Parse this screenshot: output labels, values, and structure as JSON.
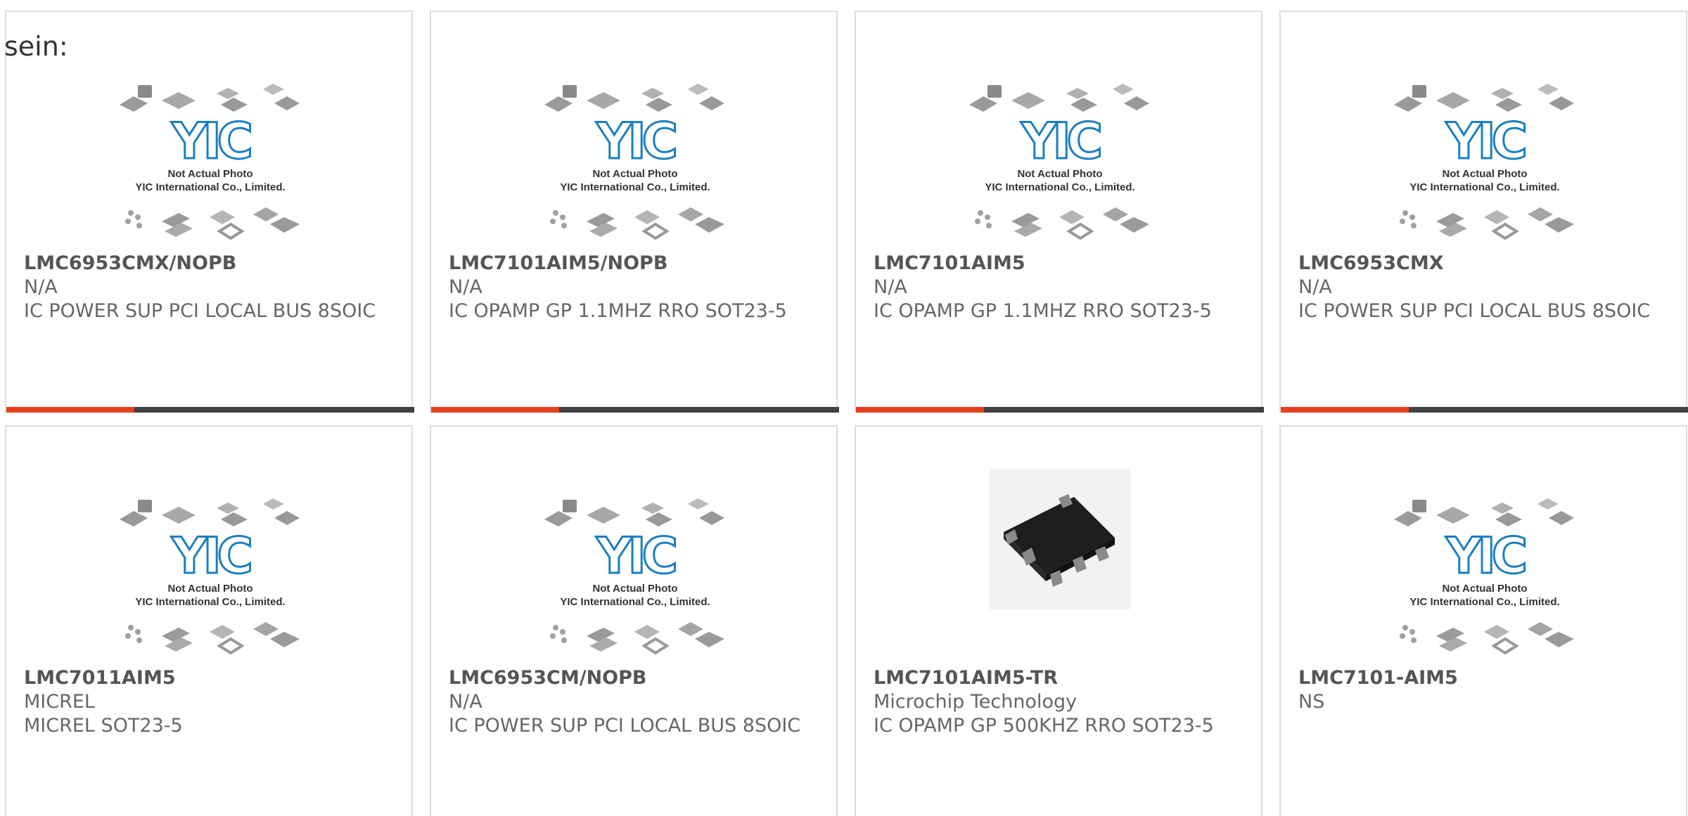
{
  "intro_text": "sein:",
  "placeholder": {
    "line1": "Not Actual Photo",
    "line2": "YIC International Co., Limited.",
    "logo": "YIC"
  },
  "colors": {
    "accent": "#e8401c",
    "bar": "#404040",
    "logo_blue": "#1a7fc1"
  },
  "products": [
    {
      "part": "LMC6953CMX/NOPB",
      "maker": "N/A",
      "desc": "IC POWER SUP PCI LOCAL BUS 8SOIC",
      "image": "placeholder"
    },
    {
      "part": "LMC7101AIM5/NOPB",
      "maker": "N/A",
      "desc": "IC OPAMP GP 1.1MHZ RRO SOT23-5",
      "image": "placeholder"
    },
    {
      "part": "LMC7101AIM5",
      "maker": "N/A",
      "desc": "IC OPAMP GP 1.1MHZ RRO SOT23-5",
      "image": "placeholder"
    },
    {
      "part": "LMC6953CMX",
      "maker": "N/A",
      "desc": "IC POWER SUP PCI LOCAL BUS 8SOIC",
      "image": "placeholder"
    },
    {
      "part": "LMC7011AIM5",
      "maker": "MICREL",
      "desc": "MICREL SOT23-5",
      "image": "placeholder"
    },
    {
      "part": "LMC6953CM/NOPB",
      "maker": "N/A",
      "desc": "IC POWER SUP PCI LOCAL BUS 8SOIC",
      "image": "placeholder"
    },
    {
      "part": "LMC7101AIM5-TR",
      "maker": "Microchip Technology",
      "desc": "IC OPAMP GP 500KHZ RRO SOT23-5",
      "image": "sot23-chip-photo"
    },
    {
      "part": "LMC7101-AIM5",
      "maker": "NS",
      "desc": "",
      "image": "placeholder"
    }
  ]
}
